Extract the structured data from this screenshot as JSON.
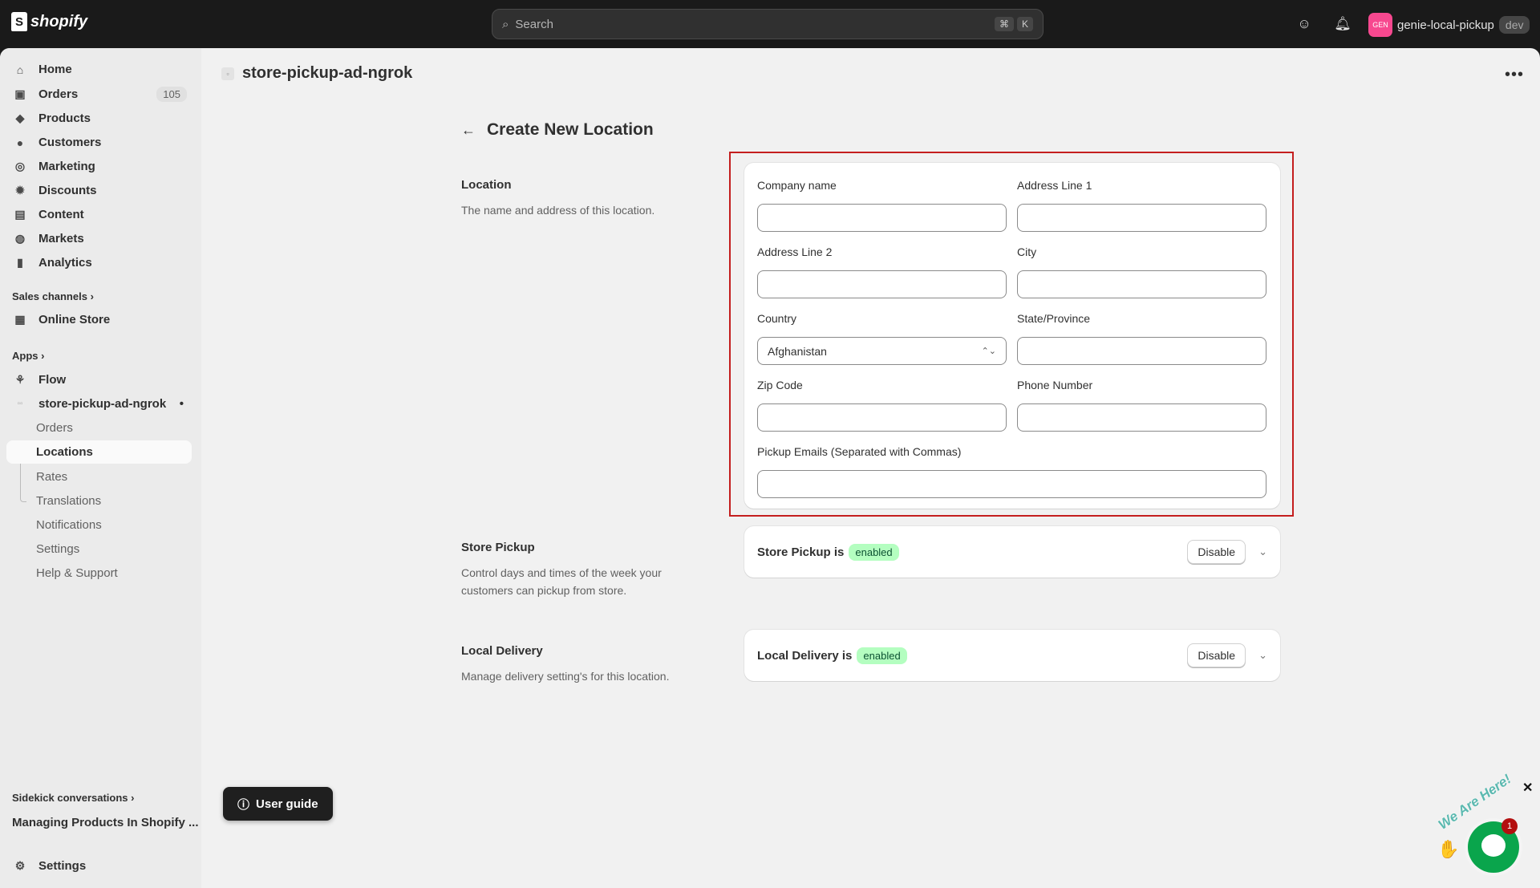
{
  "topbar": {
    "brand": "shopify",
    "search_placeholder": "Search",
    "kbd": [
      "⌘",
      "K"
    ],
    "store_initials": "GEN",
    "store_name": "genie-local-pickup",
    "store_badge": "dev"
  },
  "sidebar": {
    "main": [
      {
        "label": "Home",
        "icon": "home-icon"
      },
      {
        "label": "Orders",
        "icon": "inbox-icon",
        "badge": "105"
      },
      {
        "label": "Products",
        "icon": "tag-icon"
      },
      {
        "label": "Customers",
        "icon": "person-icon"
      },
      {
        "label": "Marketing",
        "icon": "target-icon"
      },
      {
        "label": "Discounts",
        "icon": "discount-icon"
      },
      {
        "label": "Content",
        "icon": "content-icon"
      },
      {
        "label": "Markets",
        "icon": "globe-icon"
      },
      {
        "label": "Analytics",
        "icon": "chart-icon"
      }
    ],
    "sales_channels": "Sales channels",
    "online_store": "Online Store",
    "apps": "Apps",
    "flow": "Flow",
    "app_name": "store-pickup-ad-ngrok",
    "app_sub": [
      "Orders",
      "Locations",
      "Rates",
      "Translations",
      "Notifications",
      "Settings",
      "Help & Support"
    ],
    "sidekick": "Sidekick conversations",
    "sidekick_item": "Managing Products In Shopify ...",
    "settings": "Settings"
  },
  "page": {
    "app_title": "store-pickup-ad-ngrok",
    "heading": "Create New Location"
  },
  "location": {
    "title": "Location",
    "desc": "The name and address of this location.",
    "fields": {
      "company": "Company name",
      "addr1": "Address Line 1",
      "addr2": "Address Line 2",
      "city": "City",
      "country": "Country",
      "country_value": "Afghanistan",
      "state": "State/Province",
      "zip": "Zip Code",
      "phone": "Phone Number",
      "emails": "Pickup Emails (Separated with Commas)"
    }
  },
  "store_pickup": {
    "title": "Store Pickup",
    "desc": "Control days and times of the week your customers can pickup from store.",
    "status_text": "Store Pickup is",
    "status": "enabled",
    "button": "Disable"
  },
  "local_delivery": {
    "title": "Local Delivery",
    "desc": "Manage delivery setting's for this location.",
    "status_text": "Local Delivery is",
    "status": "enabled",
    "button": "Disable"
  },
  "user_guide": "User guide",
  "chat": {
    "tagline": "We Are Here!",
    "count": "1"
  }
}
